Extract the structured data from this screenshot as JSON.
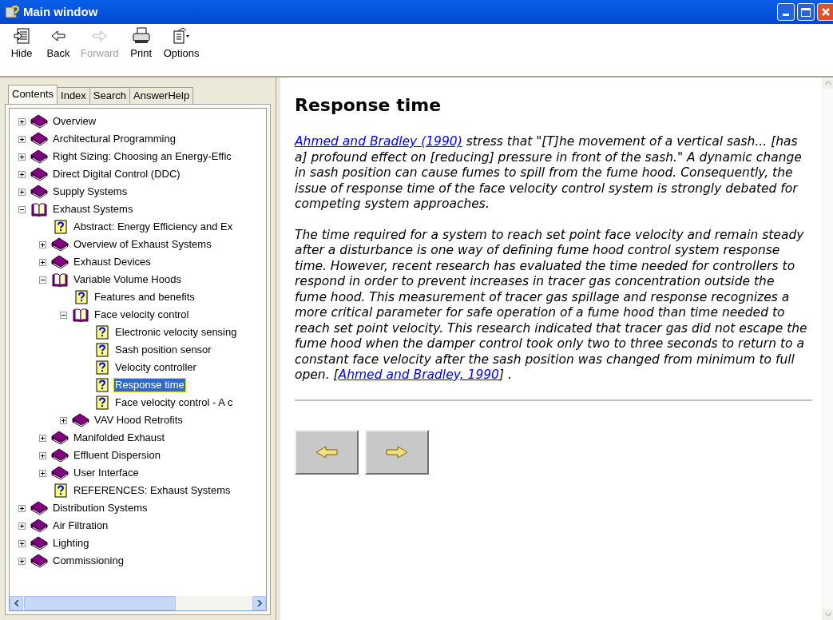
{
  "window": {
    "title": "Main window"
  },
  "toolbar": [
    {
      "kind": "hide",
      "label": "Hide",
      "disabled": false
    },
    {
      "kind": "back",
      "label": "Back",
      "disabled": false
    },
    {
      "kind": "forward",
      "label": "Forward",
      "disabled": true
    },
    {
      "kind": "print",
      "label": "Print",
      "disabled": false
    },
    {
      "kind": "options",
      "label": "Options",
      "disabled": false
    }
  ],
  "tabs": [
    {
      "label": "Contents",
      "selected": true
    },
    {
      "label": "Index",
      "selected": false
    },
    {
      "label": "Search",
      "selected": false
    },
    {
      "label": "AnswerHelp",
      "selected": false
    }
  ],
  "tree": [
    {
      "kind": "book",
      "label": "Overview",
      "expanded": false,
      "selected": false
    },
    {
      "kind": "book",
      "label": "Architectural Programming",
      "expanded": false,
      "selected": false
    },
    {
      "kind": "book",
      "label": "Right Sizing:  Choosing an Energy-Effic",
      "expanded": false,
      "selected": false
    },
    {
      "kind": "book",
      "label": "Direct Digital Control (DDC)",
      "expanded": false,
      "selected": false
    },
    {
      "kind": "book",
      "label": "Supply Systems",
      "expanded": false,
      "selected": false
    },
    {
      "kind": "book",
      "label": "Exhaust Systems",
      "expanded": true,
      "selected": false,
      "children": [
        {
          "kind": "topic",
          "label": "Abstract:  Energy Efficiency and Ex",
          "selected": false
        },
        {
          "kind": "book",
          "label": "Overview of Exhaust Systems",
          "expanded": false,
          "selected": false
        },
        {
          "kind": "book",
          "label": "Exhaust Devices",
          "expanded": false,
          "selected": false
        },
        {
          "kind": "book",
          "label": "Variable Volume Hoods",
          "expanded": true,
          "selected": false,
          "children": [
            {
              "kind": "topic",
              "label": "Features and benefits",
              "selected": false
            },
            {
              "kind": "book",
              "label": "Face velocity control",
              "expanded": true,
              "selected": false,
              "children": [
                {
                  "kind": "topic",
                  "label": "Electronic velocity sensing",
                  "selected": false
                },
                {
                  "kind": "topic",
                  "label": "Sash position sensor",
                  "selected": false
                },
                {
                  "kind": "topic",
                  "label": "Velocity controller",
                  "selected": false
                },
                {
                  "kind": "topic",
                  "label": "Response time",
                  "selected": true
                },
                {
                  "kind": "topic",
                  "label": "Face velocity control - A c",
                  "selected": false
                }
              ]
            },
            {
              "kind": "book",
              "label": "VAV Hood Retrofits",
              "expanded": false,
              "selected": false
            }
          ]
        },
        {
          "kind": "book",
          "label": "Manifolded Exhaust",
          "expanded": false,
          "selected": false
        },
        {
          "kind": "book",
          "label": "Effluent Dispersion",
          "expanded": false,
          "selected": false
        },
        {
          "kind": "book",
          "label": "User Interface",
          "expanded": false,
          "selected": false
        },
        {
          "kind": "topic",
          "label": "REFERENCES:  Exhaust Systems",
          "selected": false
        }
      ]
    },
    {
      "kind": "book",
      "label": "Distribution Systems",
      "expanded": false,
      "selected": false
    },
    {
      "kind": "book",
      "label": "Air Filtration",
      "expanded": false,
      "selected": false
    },
    {
      "kind": "book",
      "label": "Lighting",
      "expanded": false,
      "selected": false
    },
    {
      "kind": "book",
      "label": "Commissioning",
      "expanded": false,
      "selected": false
    }
  ],
  "article": {
    "title": "Response time",
    "paragraphs": [
      [
        {
          "kind": "link",
          "text": "Ahmed and Bradley (1990)"
        },
        {
          "kind": "text",
          "text": " stress that \"[T]he movement of a vertical sash... [has a] profound effect on [reducing] pressure in front of the sash.\" A dynamic change in sash position can cause fumes to spill from the fume hood. Consequently, the issue of response time of the face velocity control system is strongly debated for competing system approaches."
        }
      ],
      [
        {
          "kind": "text",
          "text": "The time required for a system to reach set point face velocity and remain steady after a disturbance is one way of defining fume hood control system response time. However, recent research has evaluated the time needed for controllers to respond in order to prevent increases in tracer gas concentration outside the fume hood. This measurement of tracer gas spillage and response recognizes a more critical parameter for safe operation of a fume hood than time needed to reach set point velocity. This research indicated that tracer gas did not escape the fume hood when the damper control took only two to three seconds to return to a constant face velocity after the sash position was changed from minimum to full open. ["
        },
        {
          "kind": "link",
          "text": "Ahmed and Bradley, 1990"
        },
        {
          "kind": "text",
          "text": "] ."
        }
      ]
    ],
    "nav": [
      {
        "kind": "previous"
      },
      {
        "kind": "next"
      }
    ]
  }
}
